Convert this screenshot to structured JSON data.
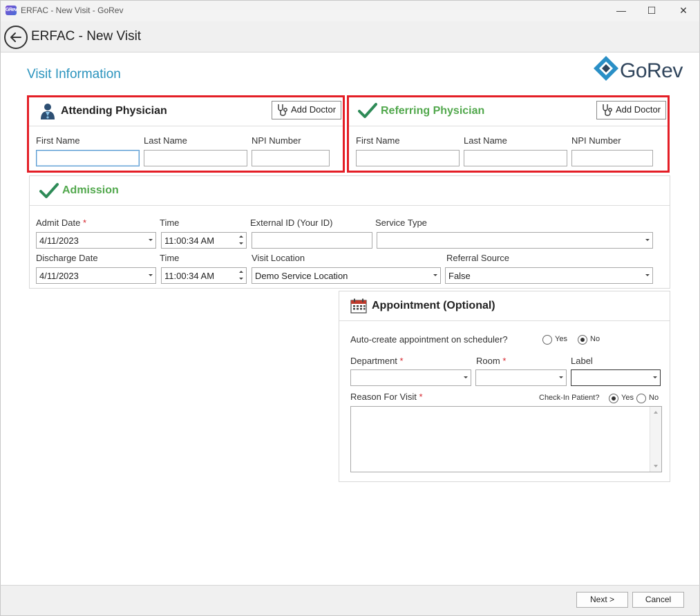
{
  "window": {
    "app_icon_text": "GRev",
    "title": "ERFAC - New Visit - GoRev",
    "minimize_glyph": "—",
    "maximize_glyph": "☐",
    "close_glyph": "✕"
  },
  "header": {
    "title": "ERFAC - New Visit"
  },
  "page": {
    "section_title": "Visit Information",
    "logo_text": "GoRev"
  },
  "attending": {
    "title": "Attending Physician",
    "add_doctor": "Add Doctor",
    "first_name_label": "First Name",
    "last_name_label": "Last Name",
    "npi_label": "NPI Number",
    "first_name_value": "",
    "last_name_value": "",
    "npi_value": ""
  },
  "referring": {
    "title": "Referring Physician",
    "add_doctor": "Add Doctor",
    "first_name_label": "First Name",
    "last_name_label": "Last Name",
    "npi_label": "NPI Number",
    "first_name_value": "",
    "last_name_value": "",
    "npi_value": ""
  },
  "admission": {
    "title": "Admission",
    "admit_date_label": "Admit Date",
    "admit_date": "4/11/2023",
    "time_label": "Time",
    "admit_time": "11:00:34 AM",
    "external_id_label": "External ID (Your ID)",
    "external_id_value": "",
    "service_type_label": "Service Type",
    "service_type_value": "",
    "discharge_date_label": "Discharge Date",
    "discharge_date": "4/11/2023",
    "discharge_time_label": "Time",
    "discharge_time": "11:00:34 AM",
    "visit_location_label": "Visit Location",
    "visit_location": "Demo Service Location",
    "referral_source_label": "Referral Source",
    "referral_source": "False",
    "required_marker": "*"
  },
  "appointment": {
    "title": "Appointment (Optional)",
    "auto_create_label": "Auto-create appointment on scheduler?",
    "yes": "Yes",
    "no": "No",
    "auto_create_selected": "No",
    "department_label": "Department",
    "department_value": "",
    "room_label": "Room",
    "room_value": "",
    "label_label": "Label",
    "label_value": "",
    "reason_label": "Reason For Visit",
    "reason_value": "",
    "checkin_label": "Check-In Patient?",
    "checkin_selected": "Yes",
    "required_marker": "*"
  },
  "footer": {
    "next": "Next >",
    "cancel": "Cancel"
  },
  "colors": {
    "accent_blue": "#2a93bd",
    "check_green": "#52a84d",
    "highlight_red": "#e41e26",
    "required_red": "#d6262e"
  }
}
